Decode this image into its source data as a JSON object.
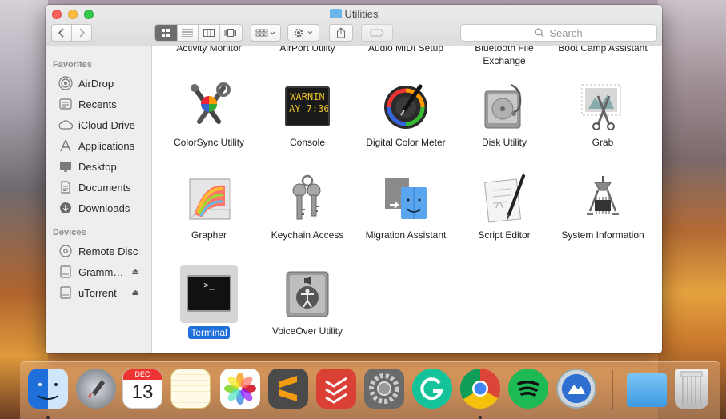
{
  "window": {
    "title": "Utilities",
    "toolbar": {
      "search_placeholder": "Search"
    }
  },
  "sidebar": {
    "favorites_header": "Favorites",
    "favorites": [
      {
        "label": "AirDrop",
        "icon": "airdrop-icon"
      },
      {
        "label": "Recents",
        "icon": "recents-icon"
      },
      {
        "label": "iCloud Drive",
        "icon": "icloud-icon"
      },
      {
        "label": "Applications",
        "icon": "applications-icon"
      },
      {
        "label": "Desktop",
        "icon": "desktop-icon"
      },
      {
        "label": "Documents",
        "icon": "documents-icon"
      },
      {
        "label": "Downloads",
        "icon": "downloads-icon"
      }
    ],
    "devices_header": "Devices",
    "devices": [
      {
        "label": "Remote Disc",
        "icon": "remote-disc-icon"
      },
      {
        "label": "Gramm…",
        "icon": "disk-icon"
      },
      {
        "label": "uTorrent",
        "icon": "disk-icon"
      }
    ]
  },
  "content": {
    "cut_row": [
      "Activity Monitor",
      "AirPort Utility",
      "Audio MIDI Setup",
      "Bluetooth File Exchange",
      "Boot Camp Assistant"
    ],
    "rows": [
      [
        {
          "label": "ColorSync Utility",
          "icon": "colorsync-icon"
        },
        {
          "label": "Console",
          "icon": "console-icon",
          "screen_text_1": "WARNIN",
          "screen_text_2": "AY 7:36"
        },
        {
          "label": "Digital Color Meter",
          "icon": "digital-color-meter-icon"
        },
        {
          "label": "Disk Utility",
          "icon": "disk-utility-icon"
        },
        {
          "label": "Grab",
          "icon": "grab-icon"
        }
      ],
      [
        {
          "label": "Grapher",
          "icon": "grapher-icon"
        },
        {
          "label": "Keychain Access",
          "icon": "keychain-icon"
        },
        {
          "label": "Migration Assistant",
          "icon": "migration-icon"
        },
        {
          "label": "Script Editor",
          "icon": "script-editor-icon"
        },
        {
          "label": "System Information",
          "icon": "system-information-icon"
        }
      ],
      [
        {
          "label": "Terminal",
          "icon": "terminal-icon",
          "selected": true,
          "prompt": ">_"
        },
        {
          "label": "VoiceOver Utility",
          "icon": "voiceover-icon"
        }
      ]
    ]
  },
  "dock": {
    "calendar_month": "DEC",
    "calendar_day": "13",
    "apps": [
      "Finder",
      "Launchpad",
      "Calendar",
      "Notes",
      "Photos",
      "Sublime Text",
      "Todoist",
      "System Preferences",
      "Grammarly",
      "Google Chrome",
      "Spotify",
      "IKE",
      "Folder",
      "Trash"
    ]
  },
  "colors": {
    "selection": "#1e6fd9",
    "close": "#fc605c",
    "minimize": "#fdbc40",
    "maximize": "#34c84a"
  }
}
